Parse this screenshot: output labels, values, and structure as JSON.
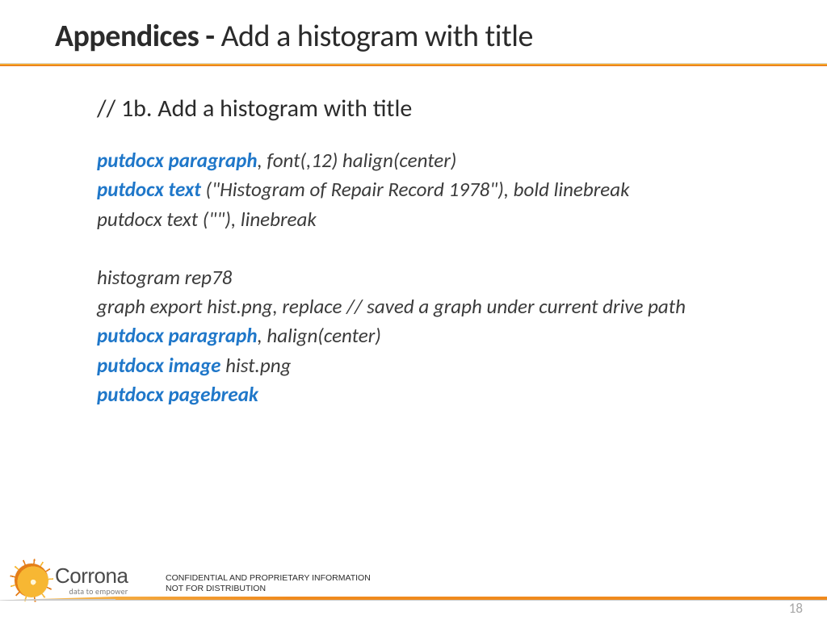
{
  "title": {
    "bold": "Appendices - ",
    "rest": "Add a histogram with title"
  },
  "subhead": "// 1b. Add a histogram with title",
  "lines": [
    {
      "parts": [
        {
          "kw": true,
          "t": "putdocx paragraph"
        },
        {
          "kw": false,
          "t": ", font(,12) halign(center)"
        }
      ]
    },
    {
      "parts": [
        {
          "kw": true,
          "t": "putdocx text "
        },
        {
          "kw": false,
          "t": "(\"Histogram of Repair Record 1978\"), bold linebreak"
        }
      ]
    },
    {
      "parts": [
        {
          "kw": false,
          "t": "putdocx text (\"\"), linebreak"
        }
      ]
    },
    {
      "gap": true
    },
    {
      "parts": [
        {
          "kw": false,
          "t": "histogram rep78"
        }
      ]
    },
    {
      "parts": [
        {
          "kw": false,
          "t": "graph export hist.png, replace  // saved a graph under current drive path"
        }
      ]
    },
    {
      "parts": [
        {
          "kw": true,
          "t": "putdocx paragraph"
        },
        {
          "kw": false,
          "t": ", halign(center)"
        }
      ]
    },
    {
      "parts": [
        {
          "kw": true,
          "t": "putdocx image "
        },
        {
          "kw": false,
          "t": "hist.png"
        }
      ]
    },
    {
      "parts": [
        {
          "kw": true,
          "t": "putdocx pagebreak"
        }
      ]
    }
  ],
  "logo": {
    "name": "Corrona",
    "tagline": "data to empower"
  },
  "confidential": {
    "l1": "CONFIDENTIAL AND PROPRIETARY INFORMATION",
    "l2": "NOT FOR DISTRIBUTION"
  },
  "page": "18"
}
